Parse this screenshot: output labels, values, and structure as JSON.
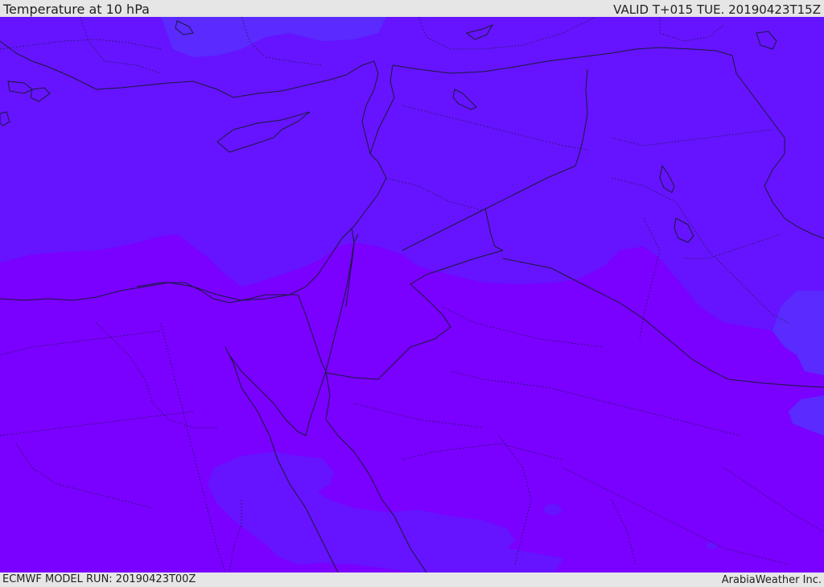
{
  "header": {
    "title": "Temperature at 10 hPa",
    "valid_time": "VALID T+015 TUE. 20190423T15Z"
  },
  "footer": {
    "model_run": "ECMWF MODEL RUN: 20190423T00Z",
    "credit": "ArabiaWeather Inc."
  },
  "colors": {
    "frame_background": "#e6e6e6",
    "warmer_band": "#7a00ff",
    "cooler_band": "#6613ff",
    "coolest_band": "#5a2aff",
    "border_line": "#1a1a3a"
  }
}
